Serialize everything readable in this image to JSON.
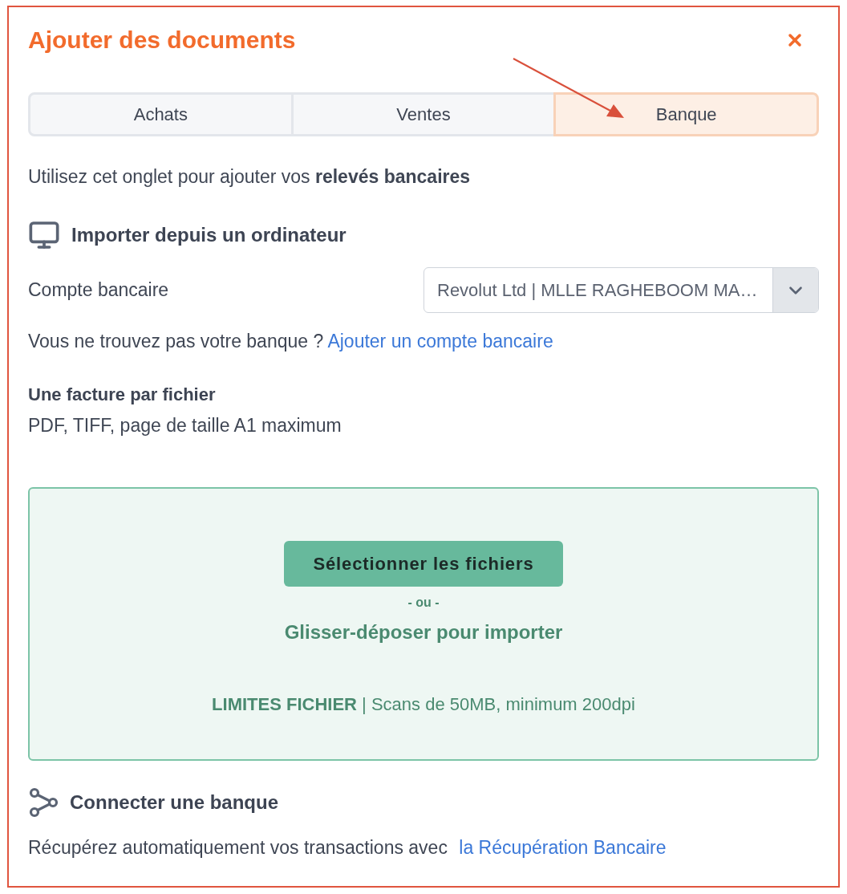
{
  "dialog": {
    "title": "Ajouter des documents"
  },
  "tabs": [
    {
      "label": "Achats",
      "selected": false
    },
    {
      "label": "Ventes",
      "selected": false
    },
    {
      "label": "Banque",
      "selected": true
    }
  ],
  "intro": "Utilisez cet onglet pour ajouter vos **relevés bancaires**",
  "import_section": {
    "heading": "Importer depuis un ordinateur",
    "account_label": "Compte bancaire",
    "account_value": "Revolut Ltd | MLLE RAGHEBOOM MA…",
    "missing_bank_text": "Vous ne trouvez pas votre banque ?",
    "missing_bank_link": "Ajouter un compte bancaire",
    "file_rule_title": "Une facture par fichier",
    "file_rule_text": "PDF, TIFF, page de taille A1 maximum"
  },
  "dropzone": {
    "button": "Sélectionner les fichiers",
    "separator": "- ou -",
    "hint": "Glisser-déposer pour importer",
    "limits": "**LIMITES FICHIER** | Scans de 50MB, minimum 200dpi"
  },
  "connect_section": {
    "heading": "Connecter une banque",
    "text": "Récupérez automatiquement vos transactions avec",
    "link": "la Récupération Bancaire"
  }
}
